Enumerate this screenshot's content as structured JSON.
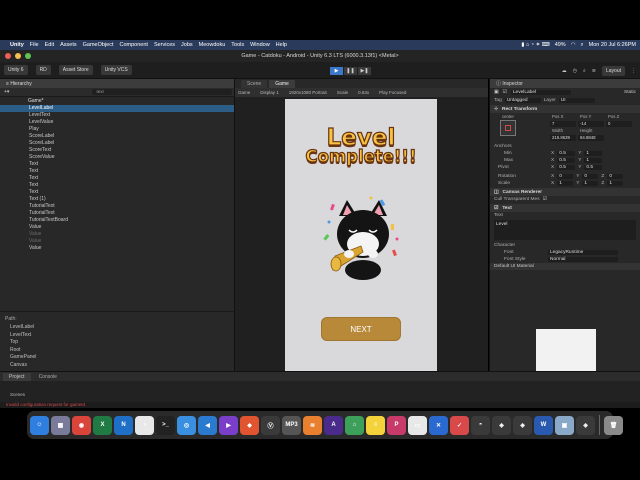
{
  "menubar": {
    "app": "Unity",
    "items": [
      "File",
      "Edit",
      "Assets",
      "GameObject",
      "Component",
      "Services",
      "Jobs",
      "Meowdoku",
      "Tools",
      "Window",
      "Help"
    ],
    "battery": "49%",
    "clock": "Mon 20 Jul  6:26PM"
  },
  "window": {
    "title": "Game - Catdoku - Android - Unity 6.3 LTS (6000.3.13f1) <Metal>"
  },
  "toolbar": {
    "unity_label": "Unity 6",
    "account": "RD",
    "asset_store": "Asset Store",
    "vcs": "Unity VCS",
    "layout": "Layout"
  },
  "hierarchy": {
    "tab": "Hierarchy",
    "search_placeholder": "text",
    "items": [
      {
        "label": "Game*",
        "kind": "root"
      },
      {
        "label": "LevelLabel",
        "kind": "selected"
      },
      {
        "label": "LevelText",
        "kind": "normal"
      },
      {
        "label": "LevelValue",
        "kind": "normal"
      },
      {
        "label": "Play",
        "kind": "normal"
      },
      {
        "label": "ScoreLabel",
        "kind": "normal"
      },
      {
        "label": "ScoreLabel",
        "kind": "normal"
      },
      {
        "label": "ScoreText",
        "kind": "normal"
      },
      {
        "label": "ScoreValue",
        "kind": "normal"
      },
      {
        "label": "Text",
        "kind": "normal"
      },
      {
        "label": "Text",
        "kind": "normal"
      },
      {
        "label": "Text",
        "kind": "normal"
      },
      {
        "label": "Text",
        "kind": "normal"
      },
      {
        "label": "Text",
        "kind": "normal"
      },
      {
        "label": "Text (1)",
        "kind": "normal"
      },
      {
        "label": "TutorialText",
        "kind": "normal"
      },
      {
        "label": "TutorialText",
        "kind": "normal"
      },
      {
        "label": "TutorialTextBoard",
        "kind": "normal"
      },
      {
        "label": "Value",
        "kind": "normal"
      },
      {
        "label": "Value",
        "kind": "disabled"
      },
      {
        "label": "Value",
        "kind": "disabled"
      },
      {
        "label": "Value",
        "kind": "normal"
      }
    ]
  },
  "path": {
    "title": "Path:",
    "items": [
      "LevelLabel",
      "LevelText",
      "Top",
      "Root",
      "GamePanel",
      "Canvas"
    ]
  },
  "game": {
    "tab_scene": "Scene",
    "tab_game": "Game",
    "display_mode": "Game",
    "display": "Display 1",
    "resolution": "1920x1080 Portrait",
    "scale_label": "Scale",
    "scale_value": "0.63x",
    "play_focused": "Play Focused",
    "title_line1": "Level",
    "title_line2": "Complete!!!",
    "next_label": "NEXT"
  },
  "inspector": {
    "tab": "Inspector",
    "object_name": "LevelLabel",
    "static_label": "Static",
    "tag_label": "Tag",
    "tag_value": "Untagged",
    "layer_label": "Layer",
    "layer_value": "UI",
    "rect_transform": "Rect Transform",
    "anchor_preset": "center",
    "pos_x_label": "Pos X",
    "pos_y_label": "Pos Y",
    "pos_z_label": "Pos Z",
    "pos_x": "7",
    "pos_y": "-14",
    "pos_z": "0",
    "width_label": "Width",
    "height_label": "Height",
    "width": "215.8639",
    "height": "94.8848",
    "anchors_label": "Anchors",
    "min_label": "Min",
    "max_label": "Max",
    "pivot_label": "Pivot",
    "min_x": "0.5",
    "min_y": "1",
    "max_x": "0.5",
    "max_y": "1",
    "pivot_x": "0.5",
    "pivot_y": "0.5",
    "rotation_label": "Rotation",
    "rot_x": "0",
    "rot_y": "0",
    "rot_z": "0",
    "scale_label": "Scale",
    "scale_x": "1",
    "scale_y": "1",
    "scale_z": "1",
    "canvas_renderer": "Canvas Renderer",
    "cull_label": "Cull Transparent Mes",
    "text_component": "Text",
    "text_field_label": "Text",
    "text_value": "Level",
    "character_label": "Character",
    "font_label": "Font",
    "font_value": "LegacyRuntime",
    "font_style_label": "Font Style",
    "font_style_value": "Normal",
    "material_label": "Default UI Material"
  },
  "bottom": {
    "tab_project": "Project",
    "tab_console": "Console",
    "scenes": "Scenes",
    "status": "Invalid configuration request for gameId"
  },
  "dock": {
    "icons": [
      {
        "name": "finder-icon",
        "color": "#2f7fe0",
        "glyph": "☺"
      },
      {
        "name": "launchpad-icon",
        "color": "#7a7a9a",
        "glyph": "▦"
      },
      {
        "name": "chrome-icon",
        "color": "#d9453b",
        "glyph": "◉"
      },
      {
        "name": "excel-icon",
        "color": "#1f7a44",
        "glyph": "X"
      },
      {
        "name": "edge-icon",
        "color": "#1f6fc6",
        "glyph": "N"
      },
      {
        "name": "color-picker-icon",
        "color": "#e8e8e8",
        "glyph": "◑"
      },
      {
        "name": "terminal-icon",
        "color": "#222222",
        "glyph": ">_"
      },
      {
        "name": "safari-icon",
        "color": "#3a8fe0",
        "glyph": "◎"
      },
      {
        "name": "vscode-icon",
        "color": "#2a7ad0",
        "glyph": "◀"
      },
      {
        "name": "visual-studio-icon",
        "color": "#7a3ec8",
        "glyph": "▶"
      },
      {
        "name": "git-icon",
        "color": "#e0552f",
        "glyph": "◆"
      },
      {
        "name": "vpn-icon",
        "color": "#3a3a3a",
        "glyph": "Ⓥ"
      },
      {
        "name": "mp3-icon",
        "color": "#555555",
        "glyph": "MP3"
      },
      {
        "name": "soundcloud-icon",
        "color": "#e88030",
        "glyph": "≋"
      },
      {
        "name": "affinity-icon",
        "color": "#4a2a8a",
        "glyph": "A"
      },
      {
        "name": "android-studio-icon",
        "color": "#3da05a",
        "glyph": "⌂"
      },
      {
        "name": "notes-icon",
        "color": "#f4d23a",
        "glyph": "≡"
      },
      {
        "name": "pencil-icon",
        "color": "#c83a6a",
        "glyph": "P"
      },
      {
        "name": "app-icon",
        "color": "#e8e8e8",
        "glyph": "▭"
      },
      {
        "name": "xcode-icon",
        "color": "#2a6ad0",
        "glyph": "✕"
      },
      {
        "name": "todo-icon",
        "color": "#d84a4a",
        "glyph": "✓"
      },
      {
        "name": "android-icon",
        "color": "#3a3a3a",
        "glyph": "◓"
      },
      {
        "name": "unity-hub-icon",
        "color": "#3a3a3a",
        "glyph": "◈"
      },
      {
        "name": "unity-icon",
        "color": "#3a3a3a",
        "glyph": "◈"
      },
      {
        "name": "word-icon",
        "color": "#2a5ab0",
        "glyph": "W"
      },
      {
        "name": "preview-icon",
        "color": "#8aa8c8",
        "glyph": "▣"
      },
      {
        "name": "unity-editor-icon",
        "color": "#3a3a3a",
        "glyph": "◈"
      },
      {
        "name": "trash-icon",
        "color": "#8a8a8a",
        "glyph": "🗑"
      }
    ]
  },
  "colors": {
    "selection": "#2c5d87",
    "play_active": "#3b78c8",
    "title_gold": "#f6c342",
    "title_outline": "#6b3410",
    "next_button": "#b9893a",
    "error_text": "#d04a4a"
  }
}
